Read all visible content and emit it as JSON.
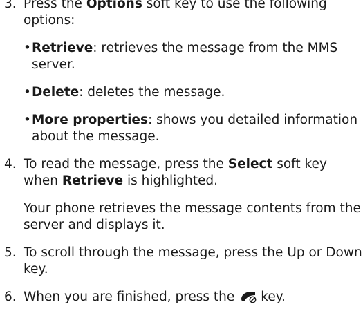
{
  "steps": [
    {
      "number": "3.",
      "pre": "Press the ",
      "bold": "Options",
      "post": " soft key to use the following options:",
      "options": [
        {
          "name": "Retrieve",
          "desc": ": retrieves the message from the MMS server."
        },
        {
          "name": "Delete",
          "desc": ": deletes the message."
        },
        {
          "name": "More properties",
          "desc": ": shows you detailed information about the message."
        }
      ]
    },
    {
      "number": "4.",
      "pre": "To read the message, press the ",
      "bold": "Select",
      "mid": " soft key when ",
      "bold2": "Retrieve",
      "post": " is highlighted.",
      "note": "Your phone retrieves the message contents from the server and displays it."
    },
    {
      "number": "5.",
      "text": "To scroll through the message, press the Up or Down key."
    },
    {
      "number": "6.",
      "pre": "When you are finished, press the",
      "icon": "end-call-key-icon",
      "post": "key."
    }
  ],
  "bullet_char": "•"
}
